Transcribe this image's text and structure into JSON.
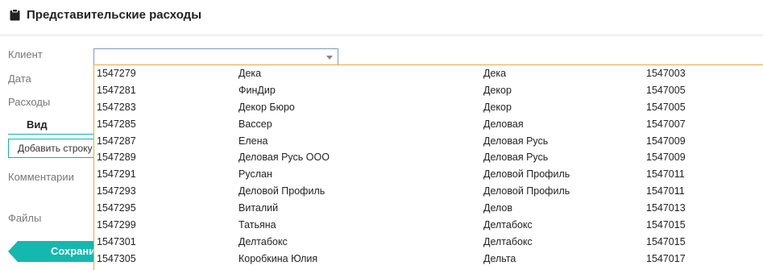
{
  "header": {
    "title": "Представительские расходы"
  },
  "form": {
    "client_label": "Клиент",
    "date_label": "Дата",
    "expenses_label": "Расходы",
    "view_column": "Вид",
    "add_row_button": "Добавить строку",
    "comments_label": "Комментарии",
    "files_label": "Файлы",
    "save_button": "Сохранить"
  },
  "client_select": {
    "value": ""
  },
  "dropdown": {
    "rows": [
      [
        "1547279",
        "Дека",
        "Дека",
        "1547003"
      ],
      [
        "1547281",
        "ФинДир",
        "Декор",
        "1547005"
      ],
      [
        "1547283",
        "Декор Бюро",
        "Декор",
        "1547005"
      ],
      [
        "1547285",
        "Вассер",
        "Деловая",
        "1547007"
      ],
      [
        "1547287",
        "Елена",
        "Деловая Русь",
        "1547009"
      ],
      [
        "1547289",
        "Деловая Русь ООО",
        "Деловая Русь",
        "1547009"
      ],
      [
        "1547291",
        "Руслан",
        "Деловой Профиль",
        "1547011"
      ],
      [
        "1547293",
        "Деловой Профиль",
        "Деловой Профиль",
        "1547011"
      ],
      [
        "1547295",
        "Виталий",
        "Делов",
        "1547013"
      ],
      [
        "1547299",
        "Татьяна",
        "Делтабокс",
        "1547015"
      ],
      [
        "1547301",
        "Делтабокс",
        "Делтабокс",
        "1547015"
      ],
      [
        "1547305",
        "Коробкина Юлия",
        "Дельта",
        "1547017"
      ]
    ]
  }
}
